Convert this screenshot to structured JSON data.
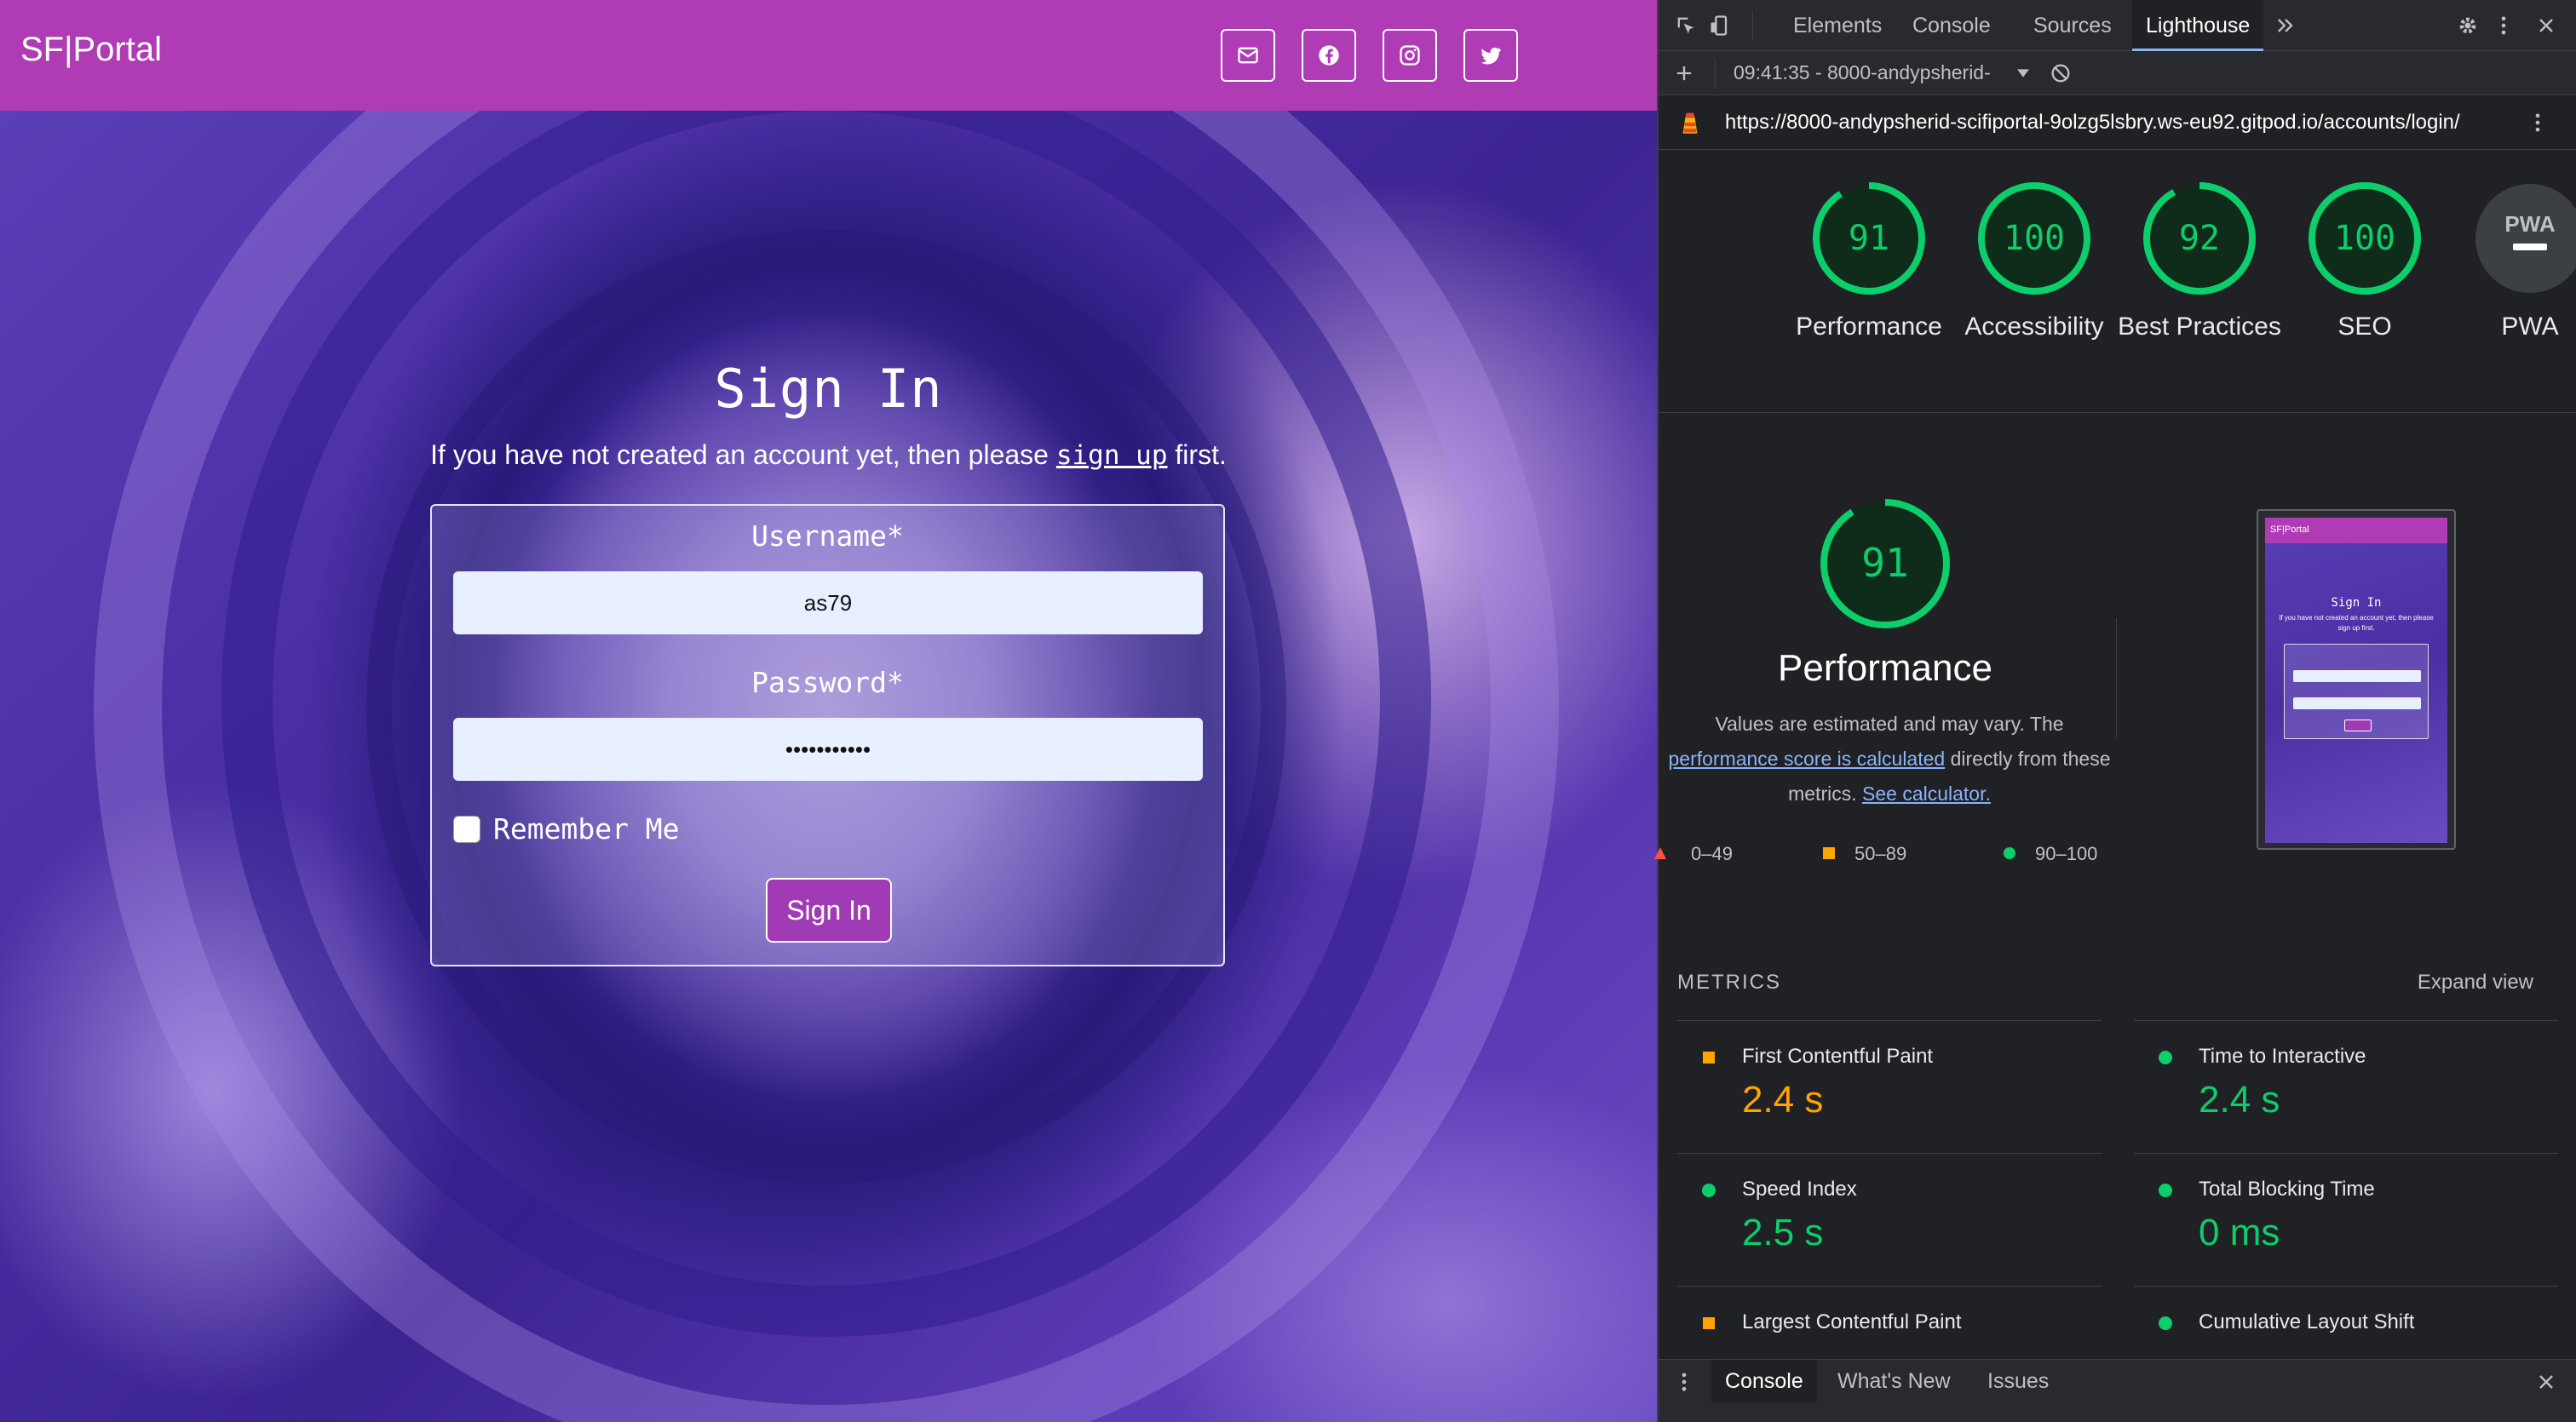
{
  "page": {
    "brand": "SF|Portal",
    "social_icons": [
      "email-icon",
      "facebook-icon",
      "instagram-icon",
      "twitter-icon"
    ],
    "title": "Sign In",
    "subtitle_before": "If you have not created an account yet, then please ",
    "subtitle_link": "sign up",
    "subtitle_after": " first.",
    "form": {
      "username_label": "Username*",
      "username_value": "as79",
      "password_label": "Password*",
      "password_value": "•••••••••••",
      "remember_label": "Remember Me",
      "remember_checked": false,
      "submit_label": "Sign In"
    },
    "colors": {
      "nav": "#b03cb5",
      "button": "#a13ab5"
    }
  },
  "devtools": {
    "tabs": [
      "Elements",
      "Console",
      "Sources",
      "Lighthouse"
    ],
    "active_tab": "Lighthouse",
    "report_select": "09:41:35 - 8000-andypsherid-",
    "url": "https://8000-andypsherid-scifiportal-9olzg5lsbry.ws-eu92.gitpod.io/accounts/login/",
    "scores": [
      {
        "label": "Performance",
        "score": "91"
      },
      {
        "label": "Accessibility",
        "score": "100"
      },
      {
        "label": "Best Practices",
        "score": "92"
      },
      {
        "label": "SEO",
        "score": "100"
      },
      {
        "label": "PWA",
        "score": "PWA"
      }
    ],
    "performance": {
      "score": "91",
      "title": "Performance",
      "desc_1": "Values are estimated and may vary. The ",
      "desc_link_1": "performance score is calculated",
      "desc_2": " directly from these metrics. ",
      "desc_link_2": "See calculator.",
      "legend": [
        "0–49",
        "50–89",
        "90–100"
      ]
    },
    "thumbnail": {
      "brand": "SF|Portal",
      "title": "Sign In",
      "subtitle": "If you have not created an account yet, then please sign up first."
    },
    "metrics_label": "METRICS",
    "expand_label": "Expand view",
    "metrics": [
      {
        "name": "First Contentful Paint",
        "value": "2.4 s",
        "status": "average"
      },
      {
        "name": "Time to Interactive",
        "value": "2.4 s",
        "status": "pass"
      },
      {
        "name": "Speed Index",
        "value": "2.5 s",
        "status": "pass"
      },
      {
        "name": "Total Blocking Time",
        "value": "0 ms",
        "status": "pass"
      },
      {
        "name": "Largest Contentful Paint",
        "value": "",
        "status": "average"
      },
      {
        "name": "Cumulative Layout Shift",
        "value": "",
        "status": "pass"
      }
    ],
    "drawer_tabs": [
      "Console",
      "What's New",
      "Issues"
    ],
    "colors": {
      "pass": "#0cce6b",
      "average": "#ffa400",
      "fail": "#ff4e42"
    }
  }
}
